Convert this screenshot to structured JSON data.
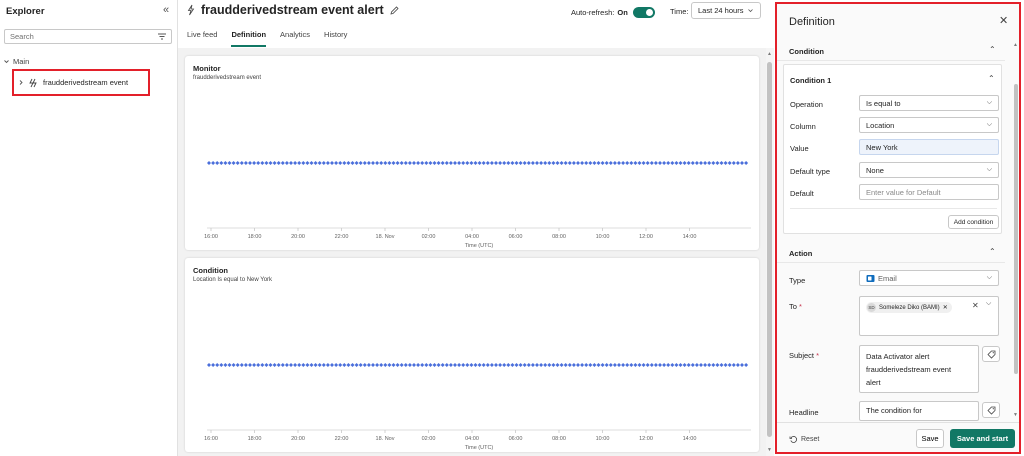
{
  "explorer": {
    "title": "Explorer",
    "search_placeholder": "Search",
    "main_label": "Main",
    "item_label": "fraudderivedstream event"
  },
  "header": {
    "title": "fraudderivedstream event alert",
    "autorefresh_label": "Auto-refresh:",
    "autorefresh_state": "On",
    "time_label": "Time:",
    "time_value": "Last 24 hours"
  },
  "tabs": [
    {
      "label": "Live feed",
      "active": false
    },
    {
      "label": "Definition",
      "active": true
    },
    {
      "label": "Analytics",
      "active": false
    },
    {
      "label": "History",
      "active": false
    }
  ],
  "monitor": {
    "title": "Monitor",
    "subtitle": "fraudderivedstream event"
  },
  "condition_card": {
    "title": "Condition",
    "subtitle": "Location Is equal to New York"
  },
  "chart_data": [
    {
      "type": "scatter",
      "title": "Monitor",
      "subtitle": "fraudderivedstream event",
      "xlabel": "Time (UTC)",
      "ylabel": "",
      "x_ticks": [
        "16:00",
        "18:00",
        "20:00",
        "22:00",
        "18. Nov",
        "02:00",
        "04:00",
        "06:00",
        "08:00",
        "10:00",
        "12:00",
        "14:00"
      ],
      "series": [
        {
          "values": [
            1
          ],
          "marker": "diamond",
          "color": "#4b6fdb",
          "density": "continuous"
        }
      ],
      "grid": false,
      "legend": "none"
    },
    {
      "type": "scatter",
      "title": "Condition",
      "subtitle": "Location Is equal to New York",
      "xlabel": "Time (UTC)",
      "ylabel": "",
      "x_ticks": [
        "16:00",
        "18:00",
        "20:00",
        "22:00",
        "18. Nov",
        "02:00",
        "04:00",
        "06:00",
        "08:00",
        "10:00",
        "12:00",
        "14:00"
      ],
      "series": [
        {
          "values": [
            1
          ],
          "marker": "diamond",
          "color": "#4b6fdb",
          "density": "continuous"
        }
      ],
      "grid": false,
      "legend": "none"
    }
  ],
  "definition": {
    "title": "Definition",
    "condition_section": "Condition",
    "condition1_title": "Condition 1",
    "operation_label": "Operation",
    "operation_value": "Is equal to",
    "column_label": "Column",
    "column_value": "Location",
    "value_label": "Value",
    "value_value": "New York",
    "default_type_label": "Default type",
    "default_type_value": "None",
    "default_label": "Default",
    "default_placeholder": "Enter value for Default",
    "add_condition": "Add condition",
    "action_section": "Action",
    "type_label": "Type",
    "type_value": "Email",
    "to_label": "To",
    "to_chip": "Someleze Diko (BAMI)",
    "to_chip_initials": "SD",
    "subject_label": "Subject",
    "subject_lines": [
      "Data Activator alert",
      "fraudderivedstream event",
      "alert"
    ],
    "headline_label": "Headline",
    "headline_value": "The condition for",
    "required_mark": "*",
    "reset": "Reset",
    "save": "Save",
    "save_and_start": "Save and start"
  },
  "colors": {
    "accent": "#117865",
    "highlight_border": "#e3202a",
    "marker": "#4b6fdb",
    "required": "#c4314b"
  }
}
